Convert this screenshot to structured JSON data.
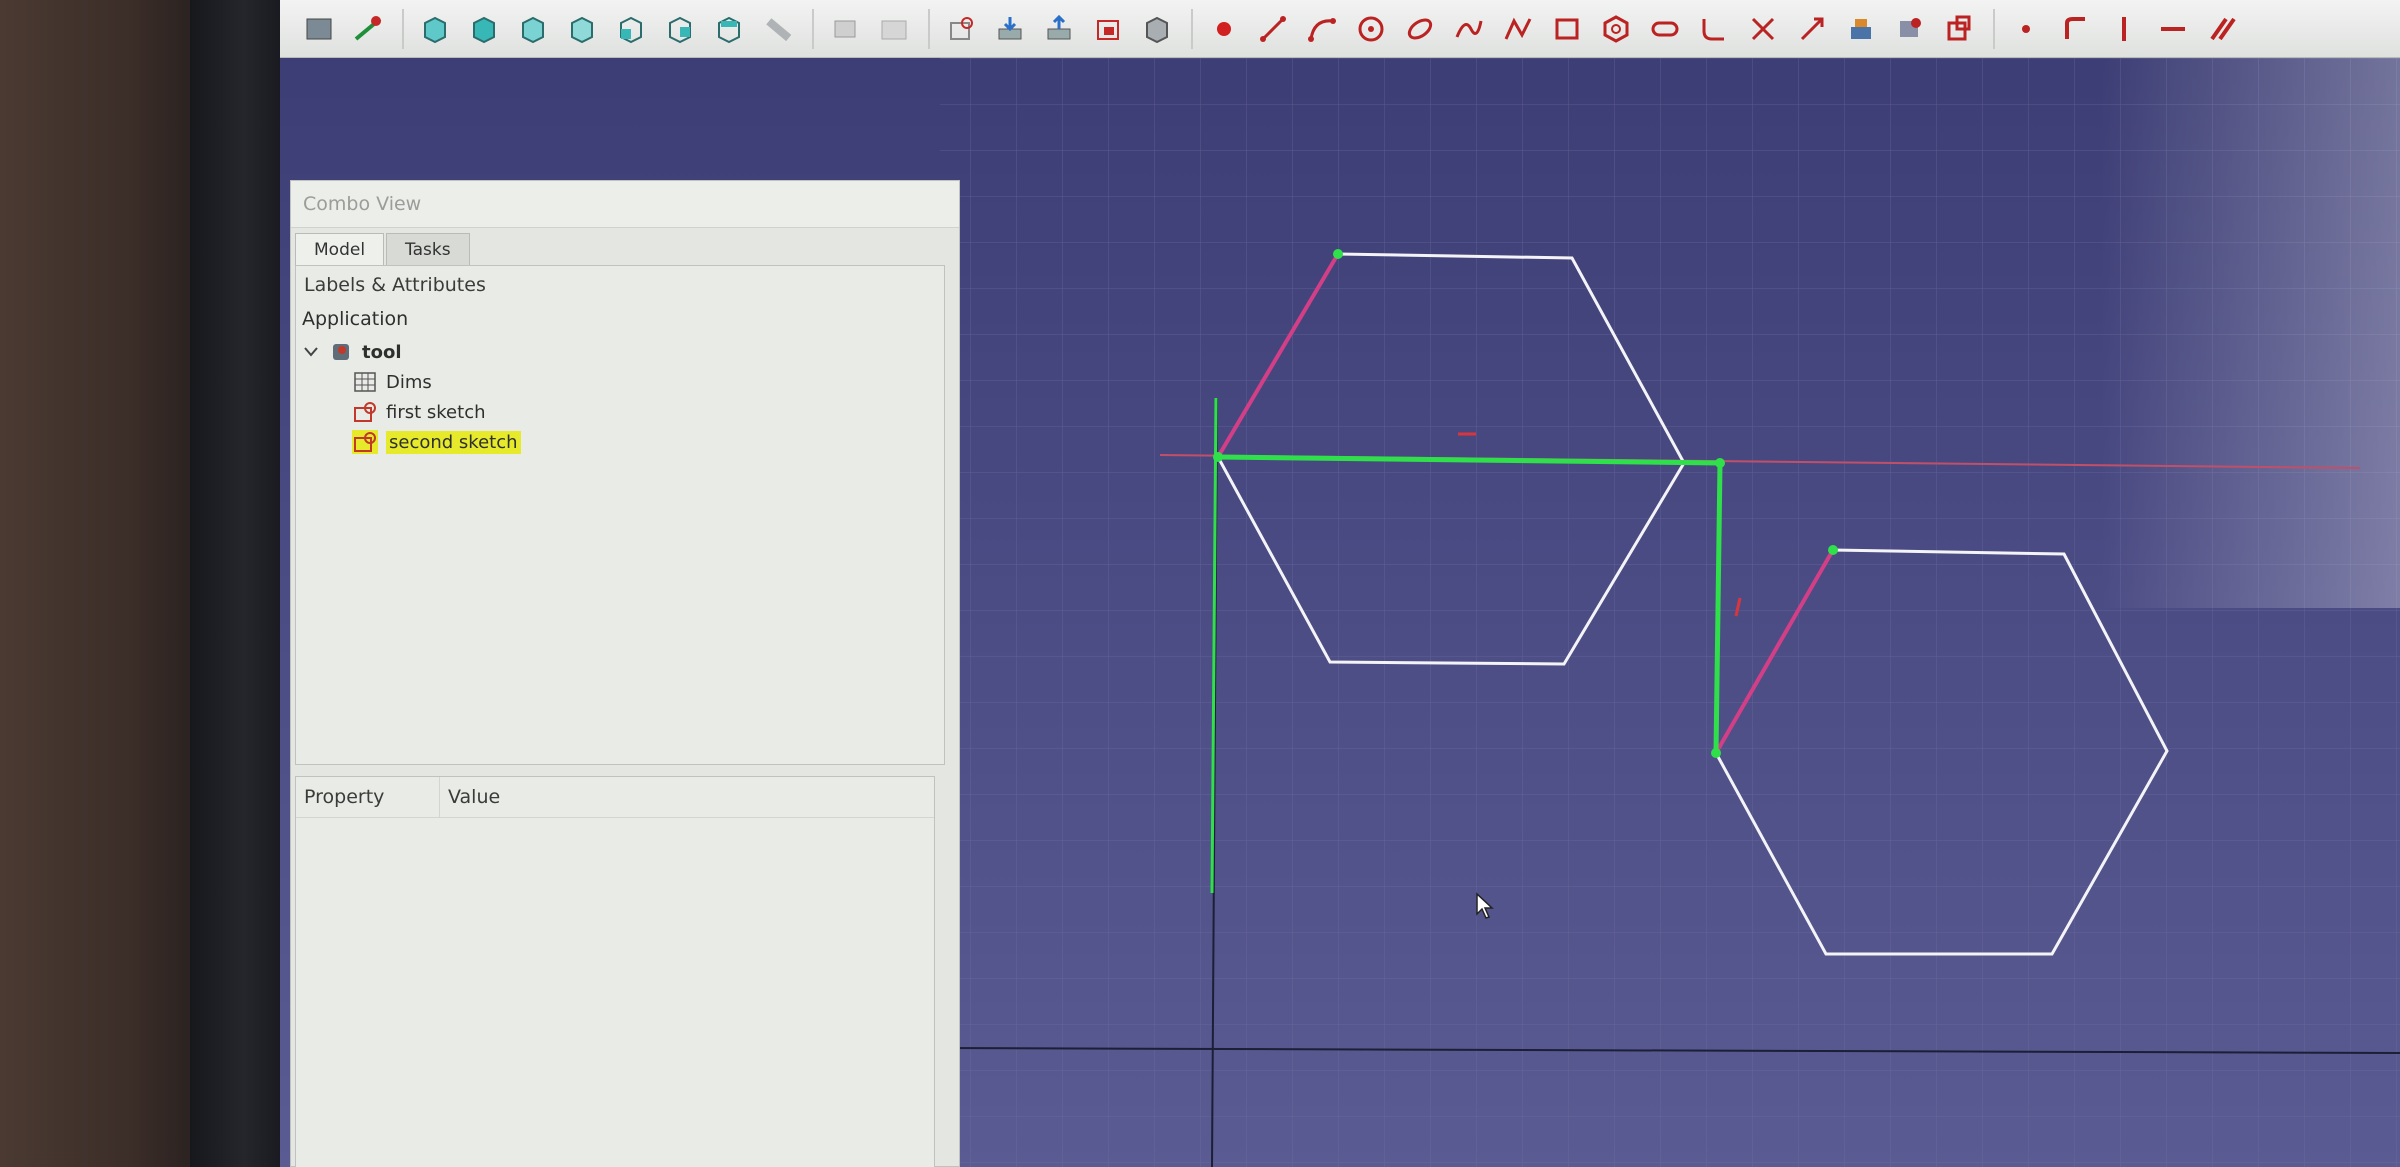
{
  "combo_view": {
    "title": "Combo View",
    "tabs": [
      {
        "label": "Model",
        "active": true
      },
      {
        "label": "Tasks",
        "active": false
      }
    ],
    "tree": {
      "header": "Labels & Attributes",
      "section": "Application",
      "document": {
        "label": "tool",
        "expanded": true,
        "icon": "document-icon"
      },
      "items": [
        {
          "label": "Dims",
          "icon": "spreadsheet-icon",
          "selected": false
        },
        {
          "label": "first sketch",
          "icon": "sketch-icon",
          "selected": false
        },
        {
          "label": "second sketch",
          "icon": "sketch-icon",
          "selected": true
        }
      ]
    },
    "properties": {
      "columns": [
        "Property",
        "Value"
      ]
    }
  },
  "toolbar": {
    "icons": [
      "part-box-icon",
      "line-tool-icon",
      "cube-icon",
      "cube-icon",
      "cube-icon",
      "cube-icon",
      "view-cube-icon",
      "view-cube-icon",
      "view-cube-icon",
      "measure-icon",
      "group-icon",
      "folder-icon",
      "shape-binder-icon",
      "import-icon",
      "export-icon",
      "sketch-map-icon",
      "sketch-validate-icon",
      "point-icon",
      "polyline-icon",
      "arc-icon",
      "circle-icon",
      "conic-icon",
      "bspline-icon",
      "polyline-node-icon",
      "rectangle-icon",
      "polygon-icon",
      "slot-icon",
      "fillet-icon",
      "trim-icon",
      "extend-icon",
      "external-geometry-icon",
      "carbon-copy-icon",
      "construction-icon",
      "constrain-point-icon",
      "constrain-vertical-icon",
      "constrain-horizontal-icon",
      "constrain-parallel-icon"
    ]
  },
  "colors": {
    "viewport_top": "#3b3c73",
    "viewport_bottom": "#5a5b92",
    "geometry": "#f4f4f6",
    "constrained": "#2fe04a",
    "construction": "#d23f86",
    "axis_x": "#c0506a",
    "selection_highlight": "#e6ea2a"
  }
}
